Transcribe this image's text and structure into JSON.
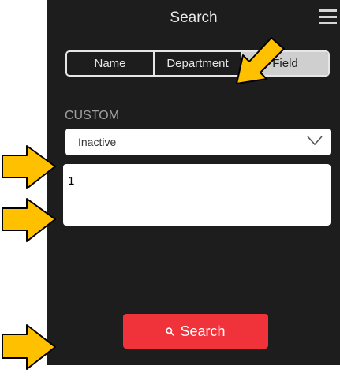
{
  "header": {
    "title": "Search",
    "menu_icon": "hamburger-menu-icon"
  },
  "tabs": [
    {
      "label": "Name",
      "active": false
    },
    {
      "label": "Department",
      "active": false
    },
    {
      "label": "Field",
      "active": true
    }
  ],
  "custom": {
    "section_label": "CUSTOM",
    "select_value": "Inactive",
    "text_value": "1"
  },
  "search_button": {
    "label": "Search",
    "icon": "search-icon"
  },
  "annotations": {
    "arrow_color": "#ffc000",
    "count": 4
  },
  "colors": {
    "background": "#1d1d1d",
    "button": "#f0323a",
    "active_tab": "#cfcfcf"
  }
}
